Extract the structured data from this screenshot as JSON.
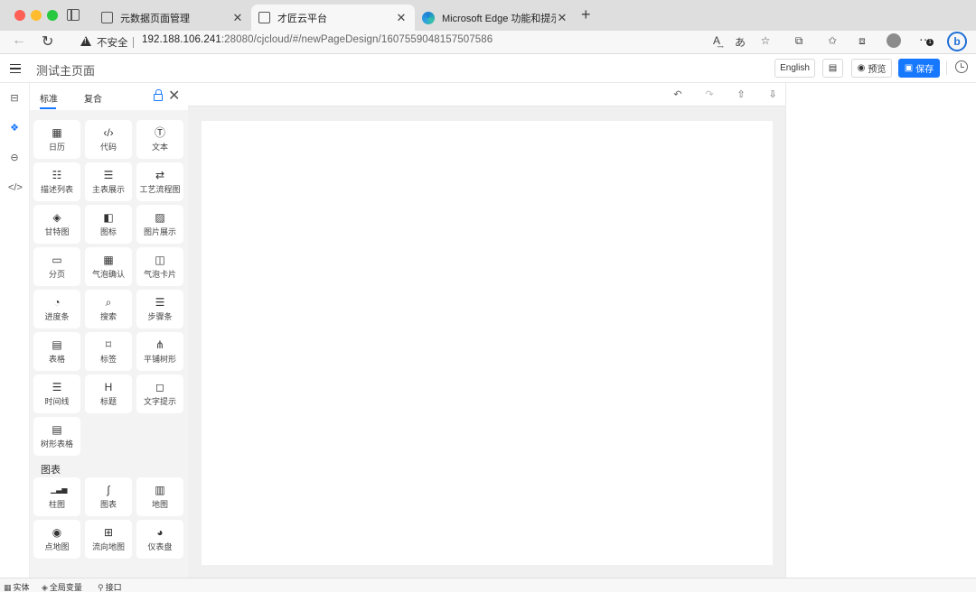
{
  "browser": {
    "tabs": [
      {
        "title": "元数据页面管理"
      },
      {
        "title": "才匠云平台"
      },
      {
        "title": "Microsoft Edge 功能和提示"
      }
    ],
    "security_label": "不安全",
    "url_host": "192.188.106.241",
    "url_path": ":28080/cjcloud/#/newPageDesign/1607559048157507586",
    "notification_count": "1"
  },
  "app": {
    "page_title": "测试主页面",
    "language_button": "English",
    "preview_button": "预览",
    "save_button": "保存",
    "accent_color": "#1677ff"
  },
  "panel": {
    "tabs": [
      "标准",
      "复合"
    ],
    "components": [
      {
        "label": "日历",
        "icon": "calendar-icon"
      },
      {
        "label": "代码",
        "icon": "code-icon"
      },
      {
        "label": "文本",
        "icon": "text-icon"
      },
      {
        "label": "描述列表",
        "icon": "description-list-icon"
      },
      {
        "label": "主表展示",
        "icon": "master-table-icon"
      },
      {
        "label": "工艺流程图",
        "icon": "process-flow-icon"
      },
      {
        "label": "甘特图",
        "icon": "gantt-icon"
      },
      {
        "label": "图标",
        "icon": "icon-component-icon"
      },
      {
        "label": "图片展示",
        "icon": "image-icon"
      },
      {
        "label": "分页",
        "icon": "pagination-icon"
      },
      {
        "label": "气泡确认",
        "icon": "popconfirm-icon"
      },
      {
        "label": "气泡卡片",
        "icon": "popover-icon"
      },
      {
        "label": "进度条",
        "icon": "progress-icon"
      },
      {
        "label": "搜索",
        "icon": "search-icon"
      },
      {
        "label": "步骤条",
        "icon": "steps-icon"
      },
      {
        "label": "表格",
        "icon": "table-icon"
      },
      {
        "label": "标签",
        "icon": "tag-icon"
      },
      {
        "label": "平铺树形",
        "icon": "tree-icon"
      },
      {
        "label": "时间线",
        "icon": "timeline-icon"
      },
      {
        "label": "标题",
        "icon": "heading-icon"
      },
      {
        "label": "文字提示",
        "icon": "tooltip-icon"
      },
      {
        "label": "树形表格",
        "icon": "tree-table-icon"
      }
    ],
    "chart_section_label": "图表",
    "chart_components": [
      {
        "label": "柱图",
        "icon": "bar-chart-icon"
      },
      {
        "label": "图表",
        "icon": "chart-icon"
      },
      {
        "label": "地图",
        "icon": "map-icon"
      },
      {
        "label": "点地图",
        "icon": "location-icon"
      },
      {
        "label": "流向地图",
        "icon": "flow-map-icon"
      },
      {
        "label": "仪表盘",
        "icon": "dashboard-icon"
      }
    ]
  },
  "statusbar": {
    "items": [
      "实体",
      "全局变量",
      "接口"
    ]
  }
}
